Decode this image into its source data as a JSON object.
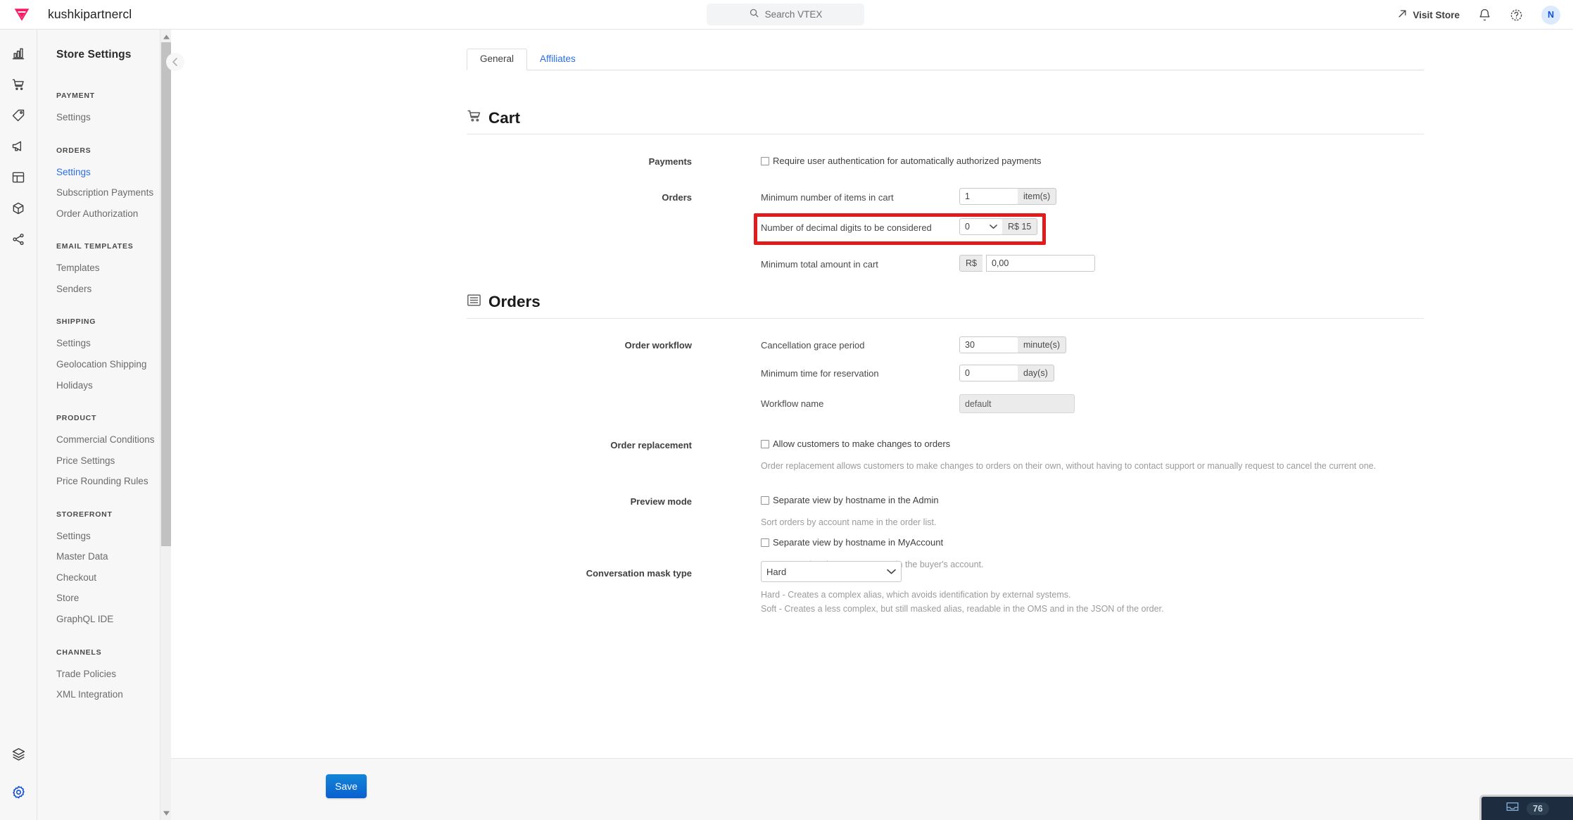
{
  "topbar": {
    "account_name": "kushkipartnercl",
    "logo_icon": "vtex-logo-icon",
    "search": {
      "placeholder": "Search VTEX",
      "icon": "search-icon"
    },
    "visit_store": {
      "label": "Visit Store",
      "icon": "external-link-icon"
    },
    "notifications_icon": "bell-icon",
    "help_icon": "question-circle-icon",
    "avatar_initial": "N"
  },
  "rail": {
    "icons": [
      "analytics-bar-chart-icon",
      "shopping-cart-icon",
      "price-tag-icon",
      "megaphone-icon",
      "layout-panel-icon",
      "box-cube-icon",
      "share-network-icon"
    ],
    "bottom_icons": [
      "layers-stack-icon",
      "gear-settings-icon"
    ]
  },
  "sidebar": {
    "title": "Store Settings",
    "groups": [
      {
        "label": "PAYMENT",
        "items": [
          {
            "label": "Settings",
            "active": false
          }
        ]
      },
      {
        "label": "ORDERS",
        "items": [
          {
            "label": "Settings",
            "active": true
          },
          {
            "label": "Subscription Payments",
            "active": false
          },
          {
            "label": "Order Authorization",
            "active": false
          }
        ]
      },
      {
        "label": "EMAIL TEMPLATES",
        "items": [
          {
            "label": "Templates",
            "active": false
          },
          {
            "label": "Senders",
            "active": false
          }
        ]
      },
      {
        "label": "SHIPPING",
        "items": [
          {
            "label": "Settings",
            "active": false
          },
          {
            "label": "Geolocation Shipping",
            "active": false
          },
          {
            "label": "Holidays",
            "active": false
          }
        ]
      },
      {
        "label": "PRODUCT",
        "items": [
          {
            "label": "Commercial Conditions",
            "active": false
          },
          {
            "label": "Price Settings",
            "active": false
          },
          {
            "label": "Price Rounding Rules",
            "active": false
          }
        ]
      },
      {
        "label": "STOREFRONT",
        "items": [
          {
            "label": "Settings",
            "active": false
          },
          {
            "label": "Master Data",
            "active": false
          },
          {
            "label": "Checkout",
            "active": false
          },
          {
            "label": "Store",
            "active": false
          },
          {
            "label": "GraphQL IDE",
            "active": false
          }
        ]
      },
      {
        "label": "CHANNELS",
        "items": [
          {
            "label": "Trade Policies",
            "active": false
          },
          {
            "label": "XML Integration",
            "active": false
          }
        ]
      }
    ]
  },
  "tabs": [
    {
      "label": "General",
      "active": true
    },
    {
      "label": "Affiliates",
      "active": false
    }
  ],
  "cart_section": {
    "heading": "Cart",
    "icon": "shopping-cart-icon",
    "payments": {
      "row_label": "Payments",
      "checkbox_label": "Require user authentication for automatically authorized payments",
      "checked": false
    },
    "orders": {
      "row_label": "Orders",
      "min_items": {
        "label": "Minimum number of items in cart",
        "value": "1",
        "suffix": "item(s)"
      },
      "decimal_digits": {
        "label": "Number of decimal digits to be considered",
        "value": "0",
        "suffix": "R$ 15",
        "highlighted": true
      },
      "min_total": {
        "label": "Minimum total amount in cart",
        "prefix": "R$",
        "value": "0,00"
      }
    }
  },
  "orders_section": {
    "heading": "Orders",
    "icon": "list-lines-icon",
    "workflow": {
      "row_label": "Order workflow",
      "cancellation": {
        "label": "Cancellation grace period",
        "value": "30",
        "suffix": "minute(s)"
      },
      "reservation": {
        "label": "Minimum time for reservation",
        "value": "0",
        "suffix": "day(s)"
      },
      "workflow_name": {
        "label": "Workflow name",
        "value": "default",
        "disabled": true
      }
    },
    "order_replacement": {
      "row_label": "Order replacement",
      "checkbox_label": "Allow customers to make changes to orders",
      "checked": false,
      "helper": "Order replacement allows customers to make changes to orders on their own, without having to contact support or manually request to cancel the current one."
    },
    "preview_mode": {
      "row_label": "Preview mode",
      "checkbox1_label": "Separate view by hostname in the Admin",
      "checkbox1_checked": false,
      "helper1": "Sort orders by account name in the order list.",
      "checkbox2_label": "Separate view by hostname in MyAccount",
      "checkbox2_checked": false,
      "helper2": "Separate orders by account name in the buyer's account."
    },
    "conversation_mask": {
      "row_label": "Conversation mask type",
      "value": "Hard",
      "helper1": "Hard - Creates a complex alias, which avoids identification by external systems.",
      "helper2": "Soft - Creates a less complex, but still masked alias, readable in the OMS and in the JSON of the order."
    }
  },
  "footer": {
    "save_label": "Save"
  },
  "widget": {
    "icon": "inbox-icon",
    "count": "76"
  },
  "colors": {
    "accent_blue": "#134cd8",
    "link_blue": "#2a6ee6",
    "vtex_pink": "#f71963",
    "highlight_red": "#e01c1c",
    "save_blue": "#0a5fd0"
  }
}
